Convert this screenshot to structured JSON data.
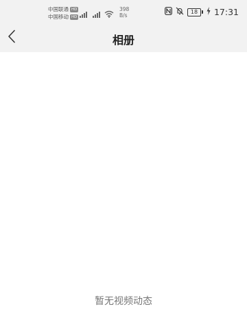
{
  "status_bar": {
    "carrier_1": "中国联通",
    "carrier_2": "中国移动",
    "hd_label": "HD",
    "net_speed_value": "398",
    "net_speed_unit": "B/s",
    "battery_level": "18",
    "time": "17:31",
    "icons": [
      "nfc-icon",
      "mute-icon",
      "battery-icon",
      "charging-icon",
      "signal-icon",
      "wifi-icon"
    ]
  },
  "header": {
    "title": "相册",
    "back_icon": "chevron-left-icon"
  },
  "main": {
    "empty_message": "暂无视频动态"
  },
  "colors": {
    "top_background": "#f2f2f2",
    "page_background": "#ffffff",
    "empty_text": "#777777"
  }
}
